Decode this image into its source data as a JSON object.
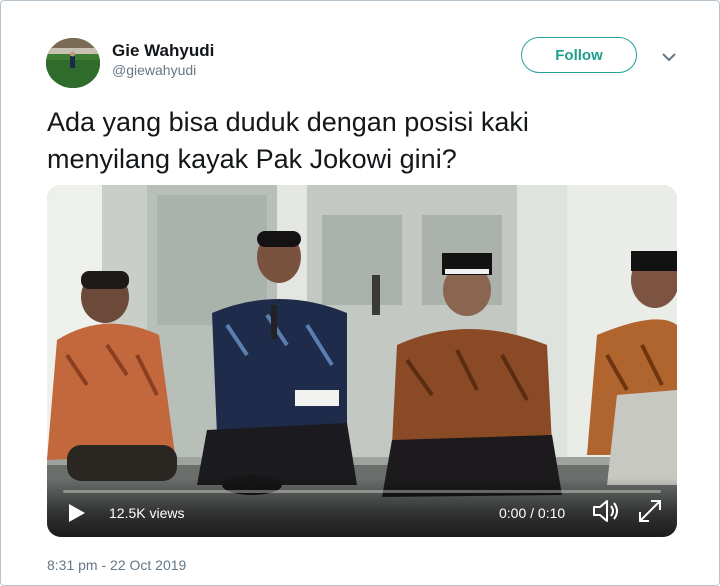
{
  "author": {
    "name": "Gie Wahyudi",
    "handle": "@giewahyudi"
  },
  "follow_label": "Follow",
  "tweet": {
    "text": "Ada yang bisa duduk dengan posisi kaki\nmenyilang kayak Pak Jokowi gini?",
    "timestamp": "8:31 pm - 22 Oct 2019"
  },
  "video": {
    "views": "12.5K views",
    "time": "0:00 / 0:10",
    "progress": 0
  },
  "icons": {
    "caret": "chevron-down-icon",
    "play": "play-icon",
    "volume": "volume-icon",
    "fullscreen": "fullscreen-icon"
  },
  "colors": {
    "follow_accent": "#1e9e8f",
    "text_primary": "#14171a",
    "text_secondary": "#657786",
    "border": "#b9c3cb"
  }
}
